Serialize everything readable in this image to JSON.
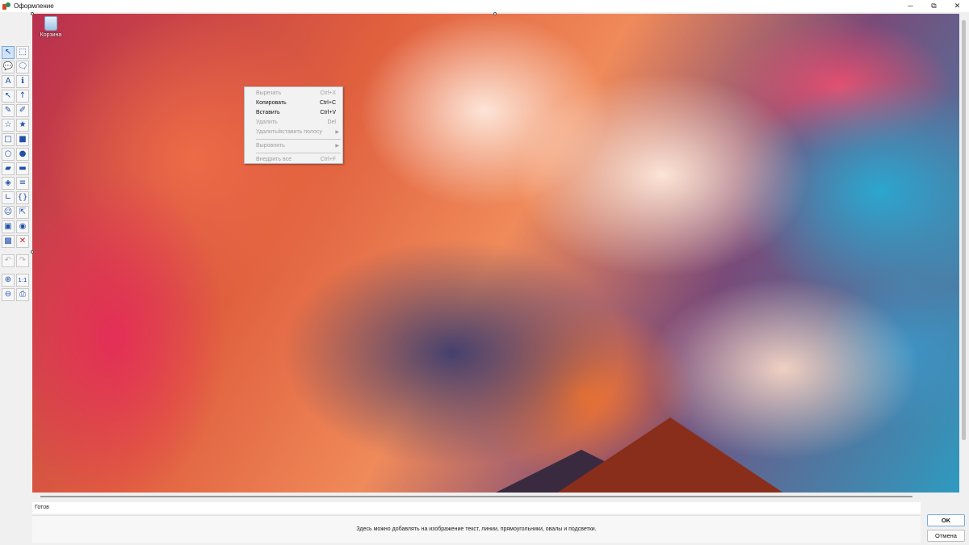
{
  "window": {
    "title": "Оформление",
    "controls": [
      "─",
      "⧉",
      "✕"
    ]
  },
  "desktop": {
    "icon_label": "Корзина"
  },
  "toolbar": {
    "tools": [
      [
        "↖",
        "⬚"
      ],
      [
        "💬",
        "🗨"
      ],
      [
        "A",
        "ℹ"
      ],
      [
        "↖",
        "↑"
      ],
      [
        "✎",
        "✐"
      ],
      [
        "☆",
        "★"
      ],
      [
        "□",
        "■"
      ],
      [
        "○",
        "●"
      ],
      [
        "▰",
        "▬"
      ],
      [
        "◈",
        "≡"
      ],
      [
        "∟",
        "{}"
      ],
      [
        "☺",
        "⇱"
      ],
      [
        "▣",
        "◉"
      ],
      [
        "▩",
        "✕"
      ]
    ],
    "history": [
      "↶",
      "↷"
    ],
    "zoom": [
      [
        "⊕",
        "1:1"
      ],
      [
        "⊖",
        "⎙"
      ]
    ]
  },
  "context_menu": {
    "items": [
      {
        "label": "Вырезать",
        "shortcut": "Ctrl+X",
        "enabled": false
      },
      {
        "label": "Копировать",
        "shortcut": "Ctrl+C",
        "enabled": true
      },
      {
        "label": "Вставить",
        "shortcut": "Ctrl+V",
        "enabled": true
      },
      {
        "label": "Удалить",
        "shortcut": "Del",
        "enabled": false
      },
      {
        "label": "Удалить/вставить полосу",
        "shortcut": "",
        "submenu": true,
        "enabled": false
      },
      {
        "separator": true
      },
      {
        "label": "Выровнять",
        "shortcut": "",
        "submenu": true,
        "enabled": false
      },
      {
        "separator": true
      },
      {
        "label": "Внедрить все",
        "shortcut": "Ctrl+F",
        "enabled": false
      }
    ]
  },
  "status": {
    "text": "Готов"
  },
  "hint": {
    "text": "Здесь можно добавлять на изображение текст, линии, прямоугольники, овалы и подсветки."
  },
  "buttons": {
    "ok": "OK",
    "cancel": "Отмена"
  }
}
